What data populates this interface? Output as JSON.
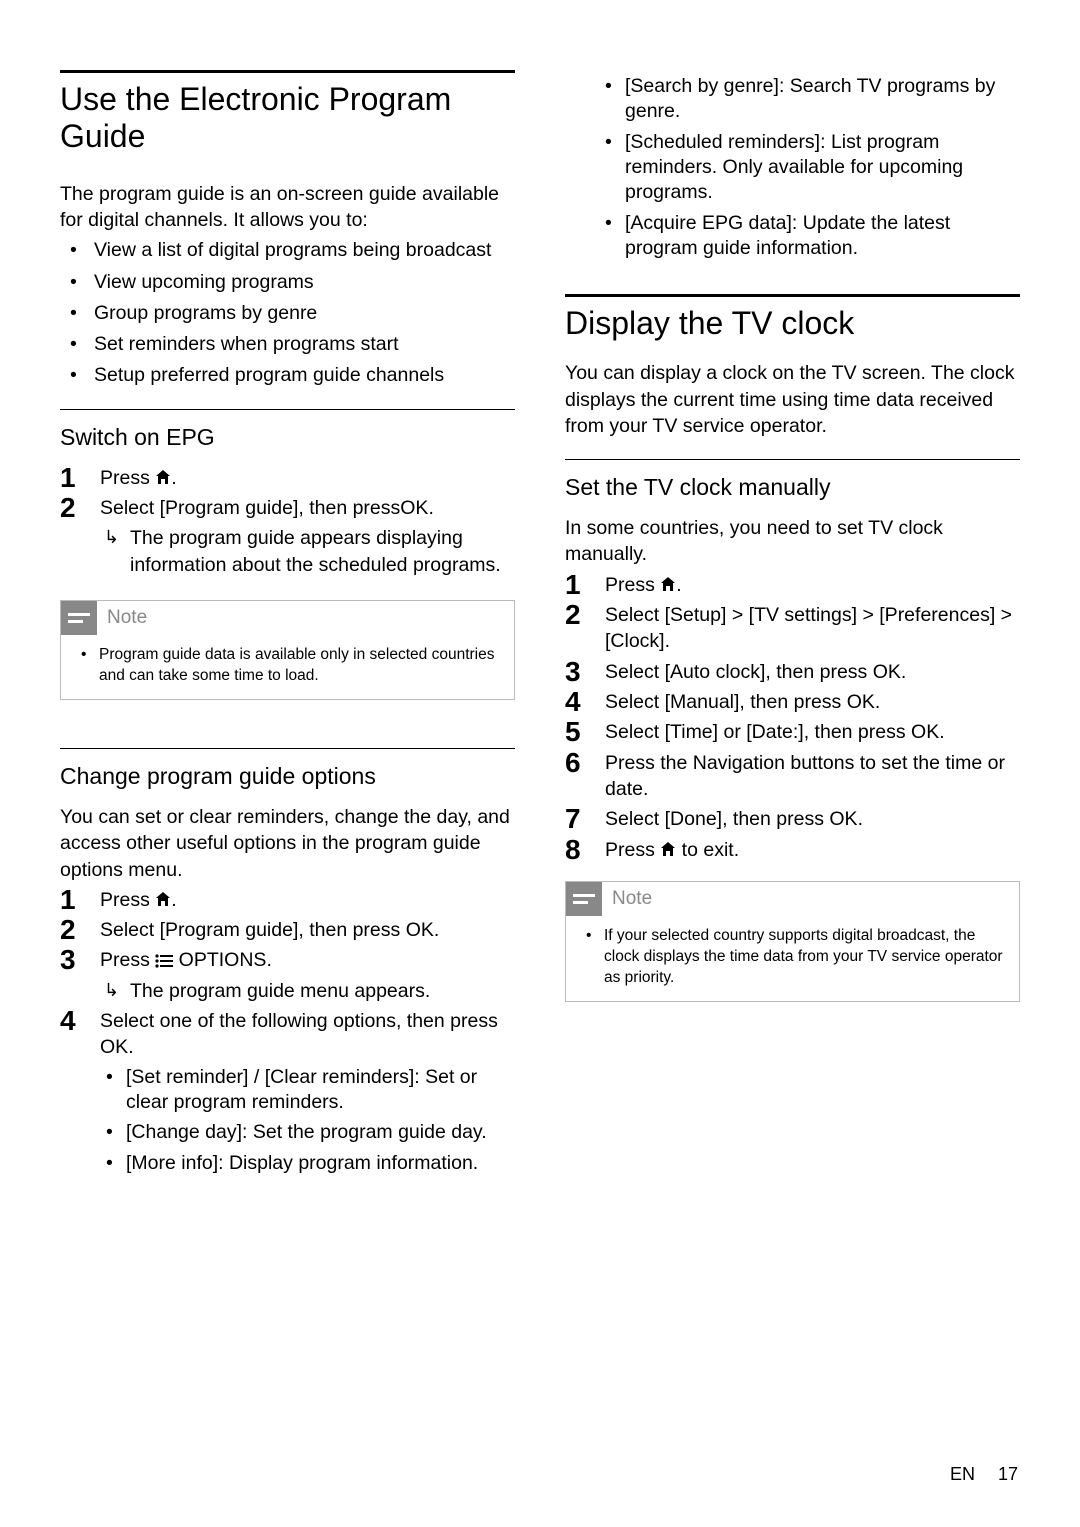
{
  "left": {
    "sec1": {
      "title": "Use the Electronic Program Guide",
      "intro": "The program guide is an on-screen guide available for digital channels. It allows you to:",
      "bullets": [
        "View a list of digital programs being broadcast",
        "View upcoming programs",
        "Group programs by genre",
        "Set reminders when programs start",
        "Setup preferred program guide channels"
      ]
    },
    "sub1": {
      "title": "Switch on EPG",
      "step1_pre": "Press ",
      "step1_post": ".",
      "step2_pre": "Select ",
      "step2_bold": "[Program guide]",
      "step2_mid": ", then press",
      "step2_ok": "OK",
      "step2_post": ".",
      "result": "The program guide appears displaying information about the scheduled programs.",
      "note_label": "Note",
      "note_text": "Program guide data is available only in selected countries and can take some time to load."
    },
    "sub2": {
      "title": "Change program guide options",
      "intro": "You can set or clear reminders, change the day, and access other useful options in the program guide options menu.",
      "step1_pre": "Press ",
      "step1_post": ".",
      "step2_pre": "Select ",
      "step2_bold": "[Program guide]",
      "step2_mid": ", then press ",
      "step2_ok": "OK",
      "step2_post": ".",
      "step3_pre": "Press ",
      "step3_bold": " OPTIONS",
      "step3_post": ".",
      "step3_result": "The program guide menu appears.",
      "step4_pre": "Select one of the following options, then press ",
      "step4_ok": "OK",
      "step4_post": ".",
      "opts": [
        {
          "b": "[Set reminder]",
          "mid": " / ",
          "b2": "[Clear reminders]",
          "t": ": Set or clear program reminders."
        },
        {
          "b": "[Change day]",
          "t": ": Set the program guide day."
        },
        {
          "b": "[More info]",
          "t": ": Display program information."
        }
      ]
    }
  },
  "right": {
    "cont_opts": [
      {
        "b": "[Search by genre]",
        "t": ": Search TV programs by genre."
      },
      {
        "b": "[Scheduled reminders]",
        "t": ": List program reminders. Only available for upcoming programs."
      },
      {
        "b": "[Acquire EPG data]",
        "t": ": Update the latest program guide information."
      }
    ],
    "sec2": {
      "title": "Display the TV clock",
      "intro": "You can display a clock on the TV screen. The clock displays the current time using time data received from your TV service operator."
    },
    "sub3": {
      "title": "Set the TV clock manually",
      "intro": "In some countries, you need to set TV clock manually.",
      "steps": {
        "s1_pre": "Press ",
        "s1_post": ".",
        "s2_pre": "Select ",
        "s2_b1": "[Setup]",
        "s2_m1": " > ",
        "s2_b2": "[TV settings]",
        "s2_m2": " > ",
        "s2_b3": "[Preferences]",
        "s2_m3": " > ",
        "s2_b4": "[Clock]",
        "s2_post": ".",
        "s3_pre": "Select ",
        "s3_b": "[Auto clock]",
        "s3_mid": ", then press ",
        "s3_ok": "OK",
        "s3_post": ".",
        "s4_pre": "Select ",
        "s4_b": "[Manual]",
        "s4_mid": ", then press ",
        "s4_ok": "OK",
        "s4_post": ".",
        "s5_pre": "Select ",
        "s5_b1": "[Time]",
        "s5_mid": " or ",
        "s5_b2": "[Date:]",
        "s5_mid2": ", then press ",
        "s5_ok": "OK",
        "s5_post": ".",
        "s6_pre": "Press the ",
        "s6_b": "Navigation buttons",
        "s6_post": " to set the time or date.",
        "s7_pre": "Select ",
        "s7_b": "[Done]",
        "s7_mid": ", then press ",
        "s7_ok": "OK",
        "s7_post": ".",
        "s8_pre": "Press ",
        "s8_post": " to exit."
      },
      "note_label": "Note",
      "note_text": "If your selected country supports digital broadcast, the clock displays the time data from your TV service operator as priority."
    }
  },
  "footer": {
    "lang": "EN",
    "page": "17"
  }
}
